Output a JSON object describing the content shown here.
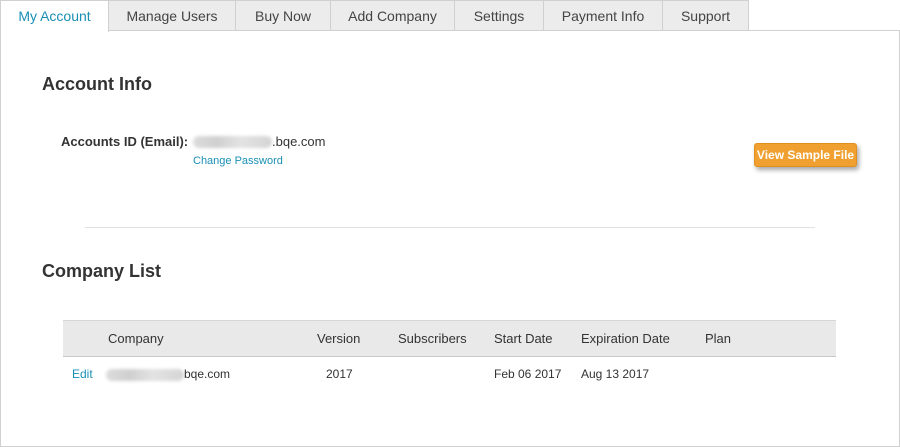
{
  "tabs": [
    {
      "label": "My Account",
      "active": true
    },
    {
      "label": "Manage Users"
    },
    {
      "label": "Buy Now"
    },
    {
      "label": "Add Company"
    },
    {
      "label": "Settings"
    },
    {
      "label": "Payment Info"
    },
    {
      "label": "Support"
    }
  ],
  "account": {
    "heading": "Account Info",
    "id_label": "Accounts ID (Email):",
    "id_domain": ".bqe.com",
    "change_password": "Change Password",
    "view_sample_file": "View Sample File"
  },
  "companies": {
    "heading": "Company List",
    "columns": [
      "Company",
      "Version",
      "Subscribers",
      "Start Date",
      "Expiration Date",
      "Plan"
    ],
    "rows": [
      {
        "action": "Edit",
        "company_domain": "bqe.com",
        "version": "2017",
        "subscribers": "",
        "start_date": "Feb 06 2017",
        "expiration_date": "Aug 13 2017",
        "plan": ""
      }
    ]
  },
  "colors": {
    "accent": "#1a8fb5",
    "button": "#f0a030",
    "tab_bg": "#ececec",
    "header_bg": "#e9e9e9"
  }
}
